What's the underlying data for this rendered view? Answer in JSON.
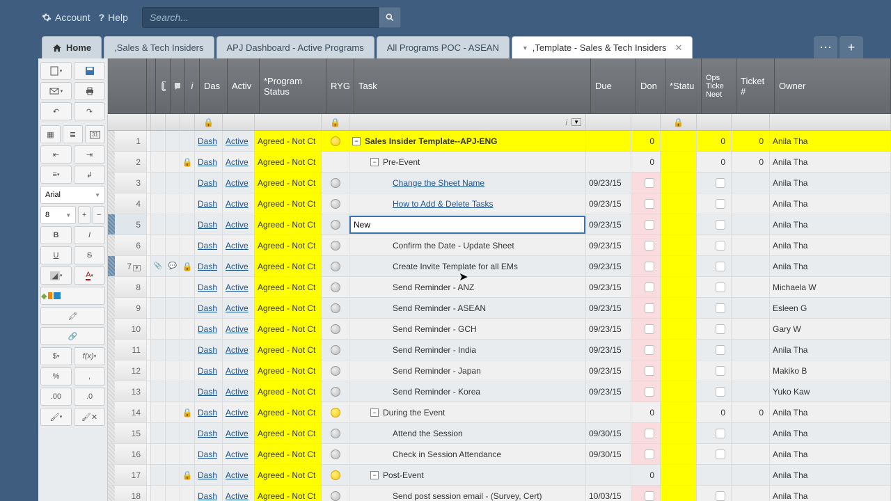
{
  "topbar": {
    "account": "Account",
    "help": "Help",
    "search_placeholder": "Search..."
  },
  "tabs": {
    "home": "Home",
    "items": [
      ",Sales & Tech Insiders",
      "APJ Dashboard - Active Programs",
      "All Programs POC - ASEAN",
      ",Template - Sales & Tech Insiders"
    ]
  },
  "toolbar": {
    "font": "Arial",
    "size": "8"
  },
  "columns": {
    "attach": "",
    "comment": "",
    "info": "i",
    "das": "Das",
    "activ": "Activ",
    "program_status": "*Program Status",
    "ryg": "RYG",
    "task": "Task",
    "due": "Due",
    "done": "Don",
    "status": "*Statu",
    "ops_ticket_need": "Ops Ticke Neet",
    "ticket_num": "Ticket #",
    "owner": "Owner"
  },
  "status_text": "Agreed - Not Ct",
  "dash_text": "Dash",
  "active_text": "Active",
  "rows": [
    {
      "n": 1,
      "type": "section",
      "ryg": "yellow",
      "task": "Sales Insider Template--APJ-ENG",
      "toggle": "-",
      "done": "0",
      "ops": "0",
      "tick": "0",
      "owner": "Anila Tha",
      "lock": false,
      "bg": "yellow"
    },
    {
      "n": 2,
      "type": "section2",
      "ryg": "",
      "task": "Pre-Event",
      "toggle": "-",
      "done": "0",
      "ops": "0",
      "tick": "0",
      "owner": "Anila Tha",
      "lock": true,
      "bg": ""
    },
    {
      "n": 3,
      "type": "link",
      "task": "Change the Sheet Name",
      "due": "09/23/15",
      "owner": "Anila Tha"
    },
    {
      "n": 4,
      "type": "link",
      "task": "How to Add & Delete Tasks",
      "due": "09/23/15",
      "owner": "Anila Tha"
    },
    {
      "n": 5,
      "type": "edit",
      "task": "New",
      "due": "09/23/15",
      "owner": "Anila Tha"
    },
    {
      "n": 6,
      "type": "text",
      "task": "Confirm the Date - Update Sheet",
      "due": "09/23/15",
      "owner": "Anila Tha"
    },
    {
      "n": 7,
      "type": "text",
      "task": "Create Invite Template for all EMs",
      "due": "09/23/15",
      "owner": "Anila Tha",
      "lock": true
    },
    {
      "n": 8,
      "type": "text",
      "task": "Send Reminder - ANZ",
      "due": "09/23/15",
      "owner": "Michaela W"
    },
    {
      "n": 9,
      "type": "text",
      "task": "Send Reminder - ASEAN",
      "due": "09/23/15",
      "owner": "Esleen G"
    },
    {
      "n": 10,
      "type": "text",
      "task": "Send Reminder - GCH",
      "due": "09/23/15",
      "owner": "Gary W"
    },
    {
      "n": 11,
      "type": "text",
      "task": "Send Reminder - India",
      "due": "09/23/15",
      "owner": "Anila Tha"
    },
    {
      "n": 12,
      "type": "text",
      "task": "Send Reminder - Japan",
      "due": "09/23/15",
      "owner": "Makiko B"
    },
    {
      "n": 13,
      "type": "text",
      "task": "Send Reminder - Korea",
      "due": "09/23/15",
      "owner": "Yuko Kaw"
    },
    {
      "n": 14,
      "type": "section2",
      "ryg": "yellow",
      "task": "During the Event",
      "toggle": "-",
      "done": "0",
      "ops": "0",
      "tick": "0",
      "owner": "Anila Tha",
      "lock": true
    },
    {
      "n": 15,
      "type": "text",
      "task": "Attend the Session",
      "due": "09/30/15",
      "owner": "Anila Tha"
    },
    {
      "n": 16,
      "type": "text",
      "task": "Check in Session Attendance",
      "due": "09/30/15",
      "owner": "Anila Tha"
    },
    {
      "n": 17,
      "type": "section2",
      "ryg": "yellow",
      "task": "Post-Event",
      "toggle": "-",
      "done": "0",
      "owner": "Anila Tha",
      "lock": true
    },
    {
      "n": 18,
      "type": "text",
      "task": "Send post session email - (Survey, Cert)",
      "due": "10/03/15",
      "owner": "Anila Tha"
    }
  ]
}
